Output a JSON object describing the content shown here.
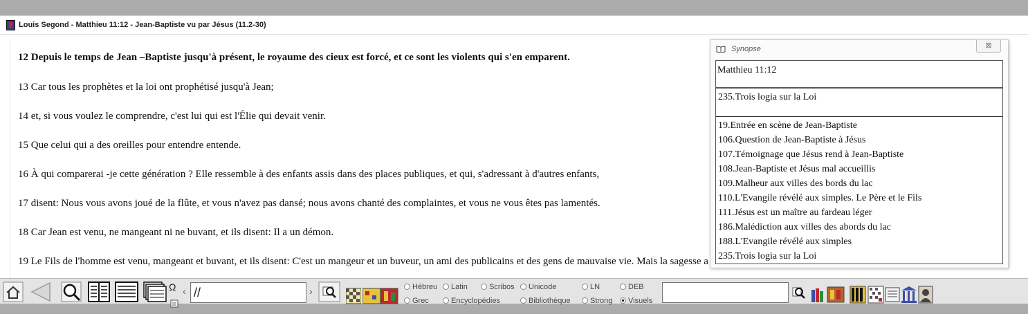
{
  "window": {
    "title": "Louis Segond - Matthieu 11:12 - Jean-Baptiste vu par Jésus (11.2-30)"
  },
  "verses": [
    {
      "text": "12 Depuis le temps de Jean –Baptiste jusqu'à présent, le royaume des cieux est forcé, et ce sont les violents qui s'en emparent.",
      "emphasis": "bold"
    },
    {
      "text": "13 Car tous les prophètes et la loi ont prophétisé jusqu'à Jean;"
    },
    {
      "text": "14 et, si vous voulez le comprendre, c'est lui qui est l'Élie qui devait venir."
    },
    {
      "text": "15 Que celui qui a des oreilles pour entendre entende."
    },
    {
      "text": "16 À qui comparerai -je cette génération ? Elle ressemble à des enfants assis dans des places publiques, et qui, s'adressant à d'autres enfants,"
    },
    {
      "text": "17 disent: Nous vous avons joué de la flûte, et vous n'avez pas dansé; nous avons chanté des complaintes, et vous ne vous êtes pas lamentés."
    },
    {
      "text": "18 Car Jean est venu, ne mangeant ni ne buvant, et ils disent: Il a un démon."
    },
    {
      "text": "19 Le Fils de l'homme est venu, mangeant et buvant, et ils disent: C'est un mangeur et un buveur, un ami des publicains et des gens de mauvaise vie. Mais la sagesse a été justifiée par ses œuvres."
    }
  ],
  "synopsis": {
    "title": "Synopse",
    "close_label": "⊠",
    "reference": "Matthieu 11:12",
    "primary_section": "235.Trois logia sur la Loi",
    "related": [
      "19.Entrée en scène de Jean-Baptiste",
      "106.Question de Jean-Baptiste à Jésus",
      "107.Témoignage que Jésus rend à Jean-Baptiste",
      "108.Jean-Baptiste et Jésus mal accueillis",
      "109.Malheur aux villes des bords du lac",
      "110.L'Evangile révélé aux simples. Le Père et le Fils",
      "111.Jésus est un maître au fardeau léger",
      "186.Malédiction aux villes des abords du lac",
      "188.L'Evangile révélé aux simples",
      "235.Trois logia sur la Loi"
    ]
  },
  "toolbar": {
    "search_value": "//",
    "omega_label": "Ω",
    "nav_left": "‹",
    "nav_right": "›",
    "radios": [
      {
        "label": "Hébreu",
        "checked": false
      },
      {
        "label": "Latin",
        "checked": false
      },
      {
        "label": "Scribos",
        "checked": false
      },
      {
        "label": "Unicode",
        "checked": false
      },
      {
        "label": "LN",
        "checked": false
      },
      {
        "label": "DEB",
        "checked": false
      },
      {
        "label": "Grec",
        "checked": false
      },
      {
        "label": "Encyclopédies",
        "checked": false
      },
      {
        "label": "Bibliothèque",
        "checked": false
      },
      {
        "label": "Strong",
        "checked": false
      },
      {
        "label": "Visuels",
        "checked": true
      }
    ]
  }
}
